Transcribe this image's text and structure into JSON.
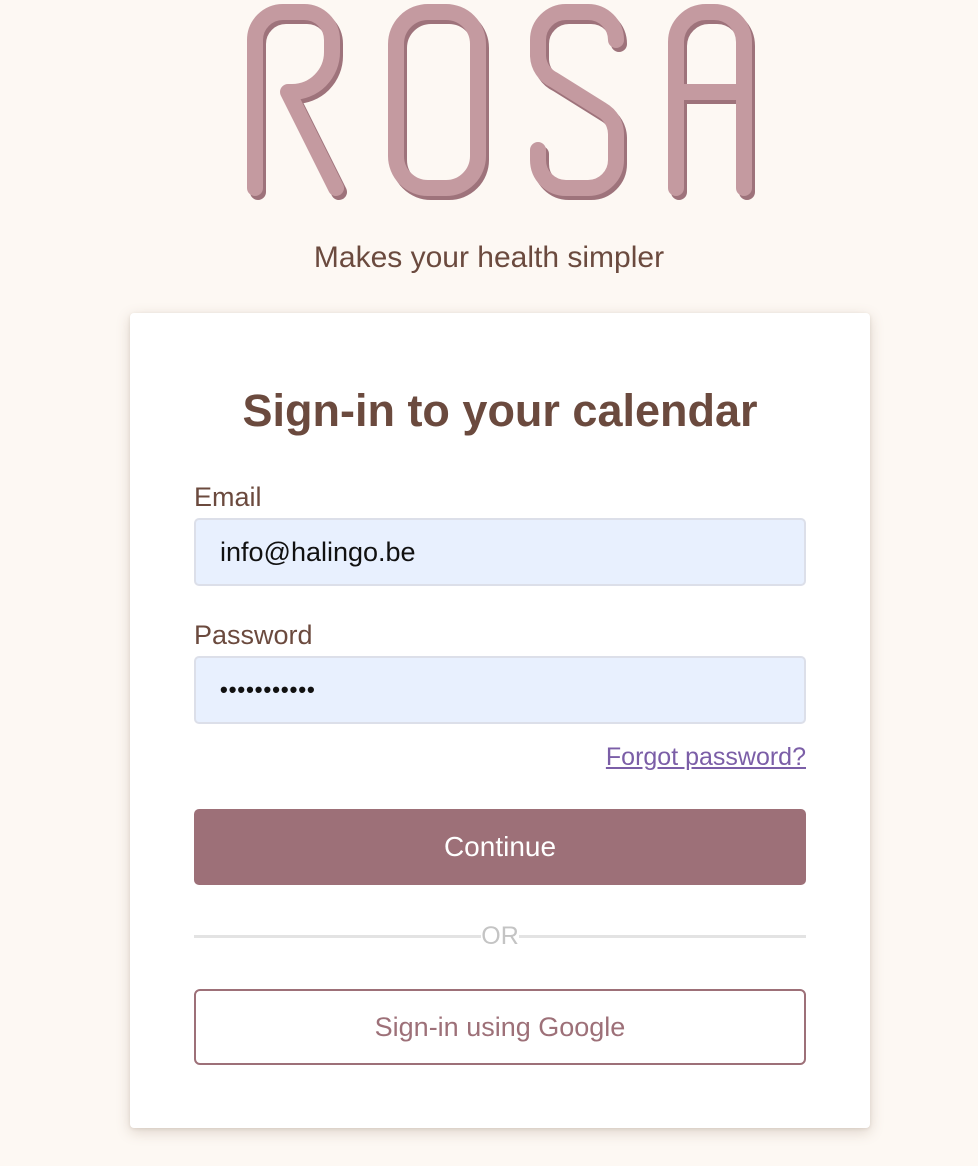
{
  "brand": {
    "logo_text": "ROSA",
    "tagline": "Makes your health simpler"
  },
  "login": {
    "title": "Sign-in to your calendar",
    "email_label": "Email",
    "email_value": "info@halingo.be",
    "password_label": "Password",
    "password_value": "•••••••••••",
    "forgot_link": "Forgot password?",
    "continue_label": "Continue",
    "divider_text": "OR",
    "google_label": "Sign-in using Google"
  },
  "colors": {
    "background": "#fdf8f3",
    "text_brown": "#6b4a3e",
    "accent_mauve": "#9d7078",
    "logo_pink": "#c49aa0",
    "link_purple": "#7b5ea7",
    "input_fill": "#e8f0fe"
  }
}
